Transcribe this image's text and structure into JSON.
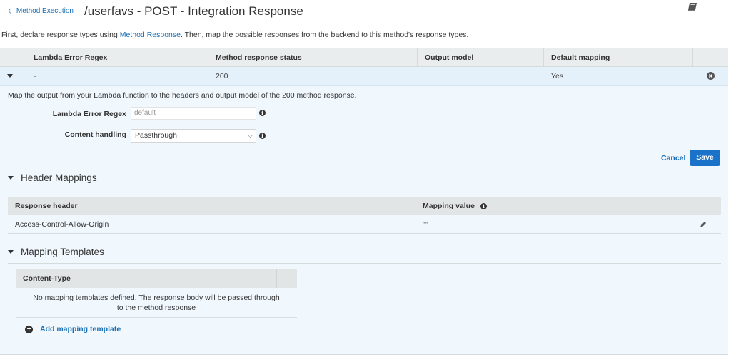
{
  "header": {
    "back_label": "Method Execution",
    "back_icon": "arrow-left-icon",
    "title": "/userfavs - POST - Integration Response",
    "help_icon": "book-icon"
  },
  "intro": {
    "before": "First, declare response types using ",
    "link": "Method Response",
    "after": ". Then, map the possible responses from the backend to this method's response types."
  },
  "responses_table": {
    "columns": [
      "Lambda Error Regex",
      "Method response status",
      "Output model",
      "Default mapping"
    ],
    "rows": [
      {
        "regex": "-",
        "status": "200",
        "output_model": "",
        "default_mapping": "Yes",
        "expanded": true
      }
    ]
  },
  "detail": {
    "description": "Map the output from your Lambda function to the headers and output model of the 200 method response.",
    "regex_label": "Lambda Error Regex",
    "regex_placeholder": "default",
    "content_handling_label": "Content handling",
    "content_handling_value": "Passthrough",
    "cancel_label": "Cancel",
    "save_label": "Save"
  },
  "header_mappings": {
    "title": "Header Mappings",
    "columns": [
      "Response header",
      "Mapping value"
    ],
    "rows": [
      {
        "header": "Access-Control-Allow-Origin",
        "value": "'*'"
      }
    ]
  },
  "mapping_templates": {
    "title": "Mapping Templates",
    "column": "Content-Type",
    "empty_message": "No mapping templates defined. The response body will be passed through to the method response",
    "add_label": "Add mapping template"
  },
  "colors": {
    "link": "#1a6fb5",
    "save_button": "#1a73c8",
    "panel_bg": "#f0f7fd",
    "selected_row_bg": "#e4f1fb",
    "header_bg": "#eaeded"
  }
}
